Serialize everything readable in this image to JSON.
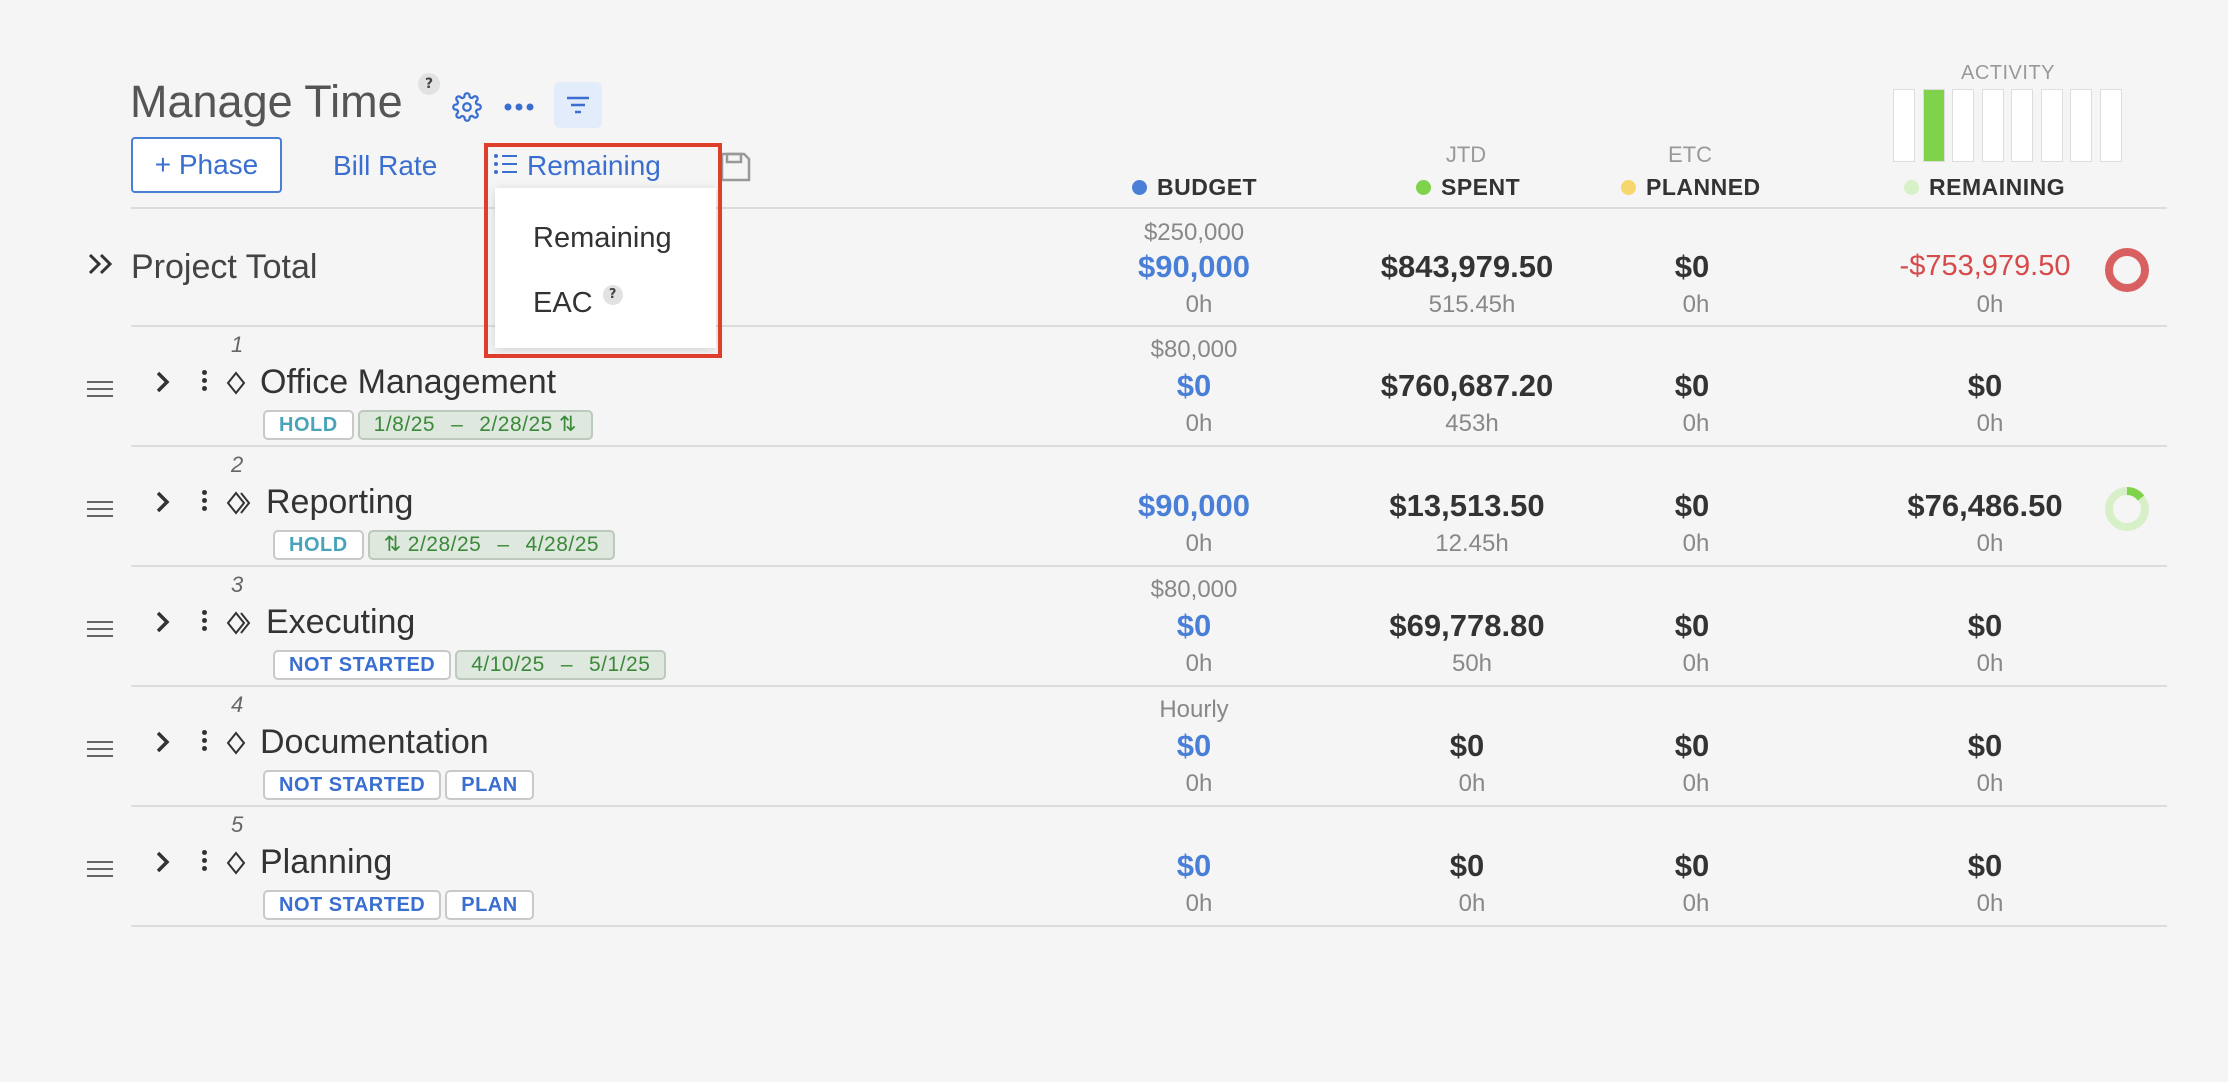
{
  "header": {
    "title": "Manage Time",
    "help_mark": "?",
    "phase_button": "+ Phase",
    "bill_rate_link": "Bill Rate",
    "view_dropdown_label": "Remaining",
    "dropdown_options": [
      "Remaining",
      "EAC"
    ]
  },
  "activity": {
    "label": "ACTIVITY",
    "bars": [
      0,
      1,
      0,
      0,
      0,
      0,
      0,
      0
    ],
    "active_color": "#7fd34a"
  },
  "columns": {
    "budget": {
      "top": "",
      "label": "BUDGET",
      "color": "#4a7fd8"
    },
    "spent": {
      "top": "JTD",
      "label": "SPENT",
      "color": "#7fd34a"
    },
    "planned": {
      "top": "ETC",
      "label": "PLANNED",
      "color": "#f5d76e"
    },
    "remaining": {
      "top": "",
      "label": "REMAINING",
      "color": "#d8f0c8"
    }
  },
  "total": {
    "name": "Project Total",
    "budget_top": "$250,000",
    "budget": "$90,000",
    "budget_hours": "0h",
    "spent": "$843,979.50",
    "spent_hours": "515.45h",
    "planned": "$0",
    "planned_hours": "0h",
    "remaining": "-$753,979.50",
    "remaining_hours": "0h"
  },
  "phases": [
    {
      "num": "1",
      "name": "Office Management",
      "status": "HOLD",
      "date_start": "1/8/25",
      "date_sep": "–",
      "date_end": "2/28/25",
      "budget_top": "$80,000",
      "budget": "$0",
      "budget_hours": "0h",
      "spent": "$760,687.20",
      "spent_hours": "453h",
      "planned": "$0",
      "planned_hours": "0h",
      "remaining": "$0",
      "remaining_hours": "0h"
    },
    {
      "num": "2",
      "name": "Reporting",
      "status": "HOLD",
      "date_start": "2/28/25",
      "date_sep": "–",
      "date_end": "4/28/25",
      "budget_top": "",
      "budget": "$90,000",
      "budget_hours": "0h",
      "spent": "$13,513.50",
      "spent_hours": "12.45h",
      "planned": "$0",
      "planned_hours": "0h",
      "remaining": "$76,486.50",
      "remaining_hours": "0h"
    },
    {
      "num": "3",
      "name": "Executing",
      "status": "NOT STARTED",
      "date_start": "4/10/25",
      "date_sep": "–",
      "date_end": "5/1/25",
      "budget_top": "$80,000",
      "budget": "$0",
      "budget_hours": "0h",
      "spent": "$69,778.80",
      "spent_hours": "50h",
      "planned": "$0",
      "planned_hours": "0h",
      "remaining": "$0",
      "remaining_hours": "0h"
    },
    {
      "num": "4",
      "name": "Documentation",
      "status": "NOT STARTED",
      "plan": "PLAN",
      "budget_top": "Hourly",
      "budget": "$0",
      "budget_hours": "0h",
      "spent": "$0",
      "spent_hours": "0h",
      "planned": "$0",
      "planned_hours": "0h",
      "remaining": "$0",
      "remaining_hours": "0h"
    },
    {
      "num": "5",
      "name": "Planning",
      "status": "NOT STARTED",
      "plan": "PLAN",
      "budget_top": "",
      "budget": "$0",
      "budget_hours": "0h",
      "spent": "$0",
      "spent_hours": "0h",
      "planned": "$0",
      "planned_hours": "0h",
      "remaining": "$0",
      "remaining_hours": "0h"
    }
  ],
  "colors": {
    "accent": "#4a7fd8",
    "negative": "#d64a4a",
    "highlight_border": "#e03e2d"
  }
}
